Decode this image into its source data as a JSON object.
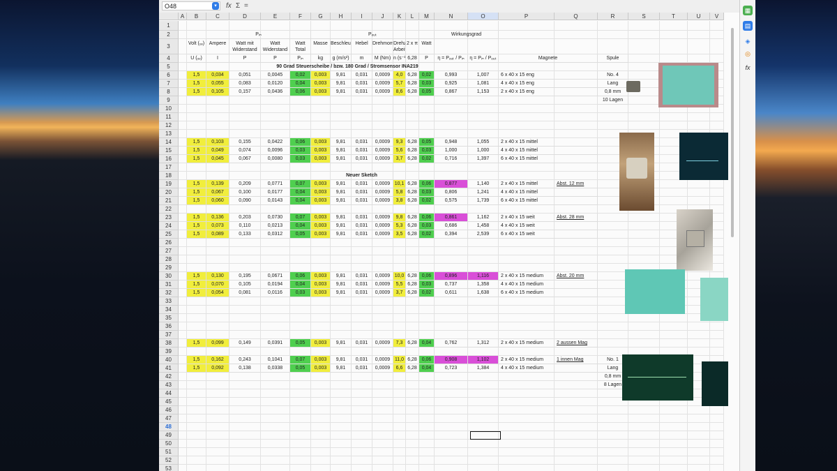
{
  "app": {
    "name_box": "O48",
    "fx_symbol": "fx",
    "sum_symbol": "Σ",
    "equals_symbol": "="
  },
  "columns": [
    "A",
    "B",
    "C",
    "D",
    "E",
    "F",
    "G",
    "H",
    "I",
    "J",
    "K",
    "L",
    "M",
    "N",
    "O",
    "P",
    "Q",
    "R",
    "S",
    "T",
    "U",
    "V"
  ],
  "rows": [
    "1",
    "2",
    "3",
    "4",
    "5",
    "6",
    "7",
    "8",
    "9",
    "10",
    "11",
    "12",
    "13",
    "14",
    "15",
    "16",
    "17",
    "18",
    "19",
    "20",
    "21",
    "22",
    "23",
    "24",
    "25",
    "26",
    "27",
    "28",
    "29",
    "30",
    "31",
    "32",
    "33",
    "34",
    "35",
    "36",
    "37",
    "38",
    "39",
    "40",
    "41",
    "42",
    "43",
    "44",
    "45",
    "46",
    "47",
    "48",
    "49",
    "50",
    "51",
    "52",
    "53"
  ],
  "selected_row": "48",
  "selected_col": "O",
  "headers": {
    "p_in": "Pᵢₙ",
    "p_out": "Pₒᵤₜ",
    "wirkungsgrad": "Wirkungsgrad",
    "volt": "Volt (ᵤᵥ)",
    "ampere": "Ampere",
    "watt_mit": "Watt mit Widerstand",
    "watt": "Watt Widerstand",
    "watt_total": "Watt Total",
    "masse": "Masse",
    "beschl": "Beschleunigung",
    "hebel": "Hebel",
    "drehmoment": "Drehmoment",
    "drehzahl": "Drehzahl Arbeit",
    "two_pi": "2 x π",
    "watt2": "Watt",
    "u_sym": "U (ᵤᵥ)",
    "i_sym": "I",
    "p_sym": "P",
    "p_sym2": "P",
    "pin_sym": "Pᵢₙ",
    "kg": "kg",
    "g_sym": "g (m/s²)",
    "m_sym": "m",
    "M_sym": "M (Nm)",
    "n_sym": "n (s⁻¹)",
    "pi_val": "6,28",
    "p_sym3": "P",
    "eta1": "η = Pₒᵤₜ / Pᵢₙ",
    "eta2": "η = Pᵢₙ / Pₒᵤₜ",
    "magnete": "Magnete",
    "spule": "Spule"
  },
  "titles": {
    "row5": "90 Grad Steuerscheibe / bzw. 180 Grad / Stromsensor INA219",
    "row18": "Neuer Sketch"
  },
  "data_rows": [
    {
      "row": "6",
      "cells": [
        "1,5",
        "0,034",
        "0,051",
        "0,0045",
        "0,02",
        "0,003",
        "9,81",
        "0,031",
        "0,0009",
        "4,0",
        "6,28",
        "0,02",
        "0,993",
        "1,007"
      ],
      "magnet": "6 x 40 x 15 eng",
      "note": "",
      "spule": "No. 4",
      "eff_pink": false
    },
    {
      "row": "7",
      "cells": [
        "1,5",
        "0,055",
        "0,083",
        "0,0120",
        "0,04",
        "0,003",
        "9,81",
        "0,031",
        "0,0009",
        "5,7",
        "6,28",
        "0,03",
        "0,925",
        "1,081"
      ],
      "magnet": "4 x 40 x 15 eng",
      "note": "",
      "spule": "Lang",
      "eff_pink": false
    },
    {
      "row": "8",
      "cells": [
        "1,5",
        "0,105",
        "0,157",
        "0,0436",
        "0,06",
        "0,003",
        "9,81",
        "0,031",
        "0,0009",
        "8,6",
        "6,28",
        "0,05",
        "0,867",
        "1,153"
      ],
      "magnet": "2 x 40 x 15 eng",
      "note": "",
      "spule": "0,8 mm",
      "eff_pink": false
    },
    {
      "row": "14",
      "cells": [
        "1,5",
        "0,103",
        "0,155",
        "0,0422",
        "0,06",
        "0,003",
        "9,81",
        "0,031",
        "0,0009",
        "9,3",
        "6,28",
        "0,05",
        "0,948",
        "1,055"
      ],
      "magnet": "2 x 40 x 15 mittel",
      "note": "",
      "spule": "",
      "eff_pink": false
    },
    {
      "row": "15",
      "cells": [
        "1,5",
        "0,049",
        "0,074",
        "0,0096",
        "0,03",
        "0,003",
        "9,81",
        "0,031",
        "0,0009",
        "5,6",
        "6,28",
        "0,03",
        "1,000",
        "1,000"
      ],
      "magnet": "4 x 40 x 15 mittel",
      "note": "",
      "spule": "",
      "eff_pink": false
    },
    {
      "row": "16",
      "cells": [
        "1,5",
        "0,045",
        "0,067",
        "0,0080",
        "0,03",
        "0,003",
        "9,81",
        "0,031",
        "0,0009",
        "3,7",
        "6,28",
        "0,02",
        "0,716",
        "1,397"
      ],
      "magnet": "6 x 40 x 15 mittel",
      "note": "",
      "spule": "",
      "eff_pink": false
    },
    {
      "row": "19",
      "cells": [
        "1,5",
        "0,139",
        "0,209",
        "0,0771",
        "0,07",
        "0,003",
        "9,81",
        "0,031",
        "0,0009",
        "10,1",
        "6,28",
        "0,06",
        "0,877",
        "1,140"
      ],
      "magnet": "2 x 40 x 15 mittel",
      "note": "Abst. 12 mm",
      "spule": "",
      "eff_pink": true
    },
    {
      "row": "20",
      "cells": [
        "1,5",
        "0,067",
        "0,100",
        "0,0177",
        "0,04",
        "0,003",
        "9,81",
        "0,031",
        "0,0009",
        "5,8",
        "6,28",
        "0,03",
        "0,806",
        "1,241"
      ],
      "magnet": "4 x 40 x 15 mittel",
      "note": "",
      "spule": "",
      "eff_pink": false
    },
    {
      "row": "21",
      "cells": [
        "1,5",
        "0,060",
        "0,090",
        "0,0143",
        "0,04",
        "0,003",
        "9,81",
        "0,031",
        "0,0009",
        "3,8",
        "6,28",
        "0,02",
        "0,575",
        "1,739"
      ],
      "magnet": "6 x 40 x 15 mittel",
      "note": "",
      "spule": "",
      "eff_pink": false
    },
    {
      "row": "23",
      "cells": [
        "1,5",
        "0,136",
        "0,203",
        "0,0730",
        "0,07",
        "0,003",
        "9,81",
        "0,031",
        "0,0009",
        "9,8",
        "6,28",
        "0,06",
        "0,861",
        "1,162"
      ],
      "magnet": "2 x 40 x 15 weit",
      "note": "Abst. 28 mm",
      "spule": "",
      "eff_pink": true
    },
    {
      "row": "24",
      "cells": [
        "1,5",
        "0,073",
        "0,110",
        "0,0213",
        "0,04",
        "0,003",
        "9,81",
        "0,031",
        "0,0009",
        "5,3",
        "6,28",
        "0,03",
        "0,686",
        "1,458"
      ],
      "magnet": "4 x 40 x 15 weit",
      "note": "",
      "spule": "",
      "eff_pink": false
    },
    {
      "row": "25",
      "cells": [
        "1,5",
        "0,089",
        "0,133",
        "0,0312",
        "0,05",
        "0,003",
        "9,81",
        "0,031",
        "0,0009",
        "3,5",
        "6,28",
        "0,02",
        "0,394",
        "2,539"
      ],
      "magnet": "6 x 40 x 15 weit",
      "note": "",
      "spule": "",
      "eff_pink": false
    },
    {
      "row": "30",
      "cells": [
        "1,5",
        "0,130",
        "0,195",
        "0,0671",
        "0,06",
        "0,003",
        "9,81",
        "0,031",
        "0,0009",
        "10,0",
        "6,28",
        "0,06",
        "0,896",
        "1,116"
      ],
      "magnet": "2 x 40 x 15 medium",
      "note": "Abst. 20 mm",
      "spule": "",
      "eff_pink": true
    },
    {
      "row": "31",
      "cells": [
        "1,5",
        "0,070",
        "0,105",
        "0,0194",
        "0,04",
        "0,003",
        "9,81",
        "0,031",
        "0,0009",
        "5,5",
        "6,28",
        "0,03",
        "0,737",
        "1,358"
      ],
      "magnet": "4 x 40 x 15 medium",
      "note": "",
      "spule": "",
      "eff_pink": false
    },
    {
      "row": "32",
      "cells": [
        "1,5",
        "0,054",
        "0,081",
        "0,0116",
        "0,03",
        "0,003",
        "9,81",
        "0,031",
        "0,0009",
        "3,7",
        "6,28",
        "0,02",
        "0,611",
        "1,638"
      ],
      "magnet": "6 x 40 x 15 medium",
      "note": "",
      "spule": "",
      "eff_pink": false
    },
    {
      "row": "38",
      "cells": [
        "1,5",
        "0,099",
        "0,149",
        "0,0391",
        "0,05",
        "0,003",
        "9,81",
        "0,031",
        "0,0009",
        "7,3",
        "6,28",
        "0,04",
        "0,762",
        "1,312"
      ],
      "magnet": "2 x 40 x 15 medium",
      "note": "2 aussen Mag",
      "spule": "",
      "eff_pink": false
    },
    {
      "row": "40",
      "cells": [
        "1,5",
        "0,162",
        "0,243",
        "0,1041",
        "0,07",
        "0,003",
        "9,81",
        "0,031",
        "0,0009",
        "11,0",
        "6,28",
        "0,06",
        "0,908",
        "1,102"
      ],
      "magnet": "2 x 40 x 15 medium",
      "note": "1 innen Mag",
      "spule": "No. 1",
      "eff_pink": true
    },
    {
      "row": "41",
      "cells": [
        "1,5",
        "0,092",
        "0,138",
        "0,0338",
        "0,05",
        "0,003",
        "9,81",
        "0,031",
        "0,0009",
        "6,6",
        "6,28",
        "0,04",
        "0,723",
        "1,384"
      ],
      "magnet": "4 x 40 x 15 medium",
      "note": "",
      "spule": "Lang",
      "eff_pink": false
    }
  ],
  "extra_spule": [
    {
      "row": "8b",
      "text": "10 Lagen",
      "top_row": "9"
    },
    {
      "row": "42",
      "text": "0,8 mm",
      "top_row": "42"
    },
    {
      "row": "43",
      "text": "8 Lagen",
      "top_row": "43"
    }
  ],
  "colors": {
    "yellow": "#f1ee3c",
    "green": "#4fcf4f",
    "magenta": "#d94fd8"
  }
}
